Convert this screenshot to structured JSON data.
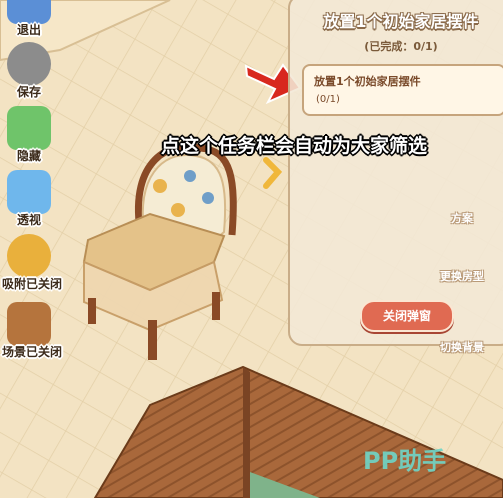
{
  "sidebar": {
    "items": [
      {
        "label": "退出",
        "icon": "exit-icon"
      },
      {
        "label": "保存",
        "icon": "save-icon"
      },
      {
        "label": "隐藏",
        "icon": "hide-icon"
      },
      {
        "label": "透视",
        "icon": "cube-icon"
      },
      {
        "label": "吸附已关闭",
        "icon": "magnet-icon"
      },
      {
        "label": "场景已关闭",
        "icon": "scene-icon"
      }
    ]
  },
  "task_panel": {
    "title": "放置1个初始家居摆件",
    "progress": "(已完成：0/1)",
    "task": {
      "name": "放置1个初始家居摆件",
      "progress": "(0/1)"
    },
    "close_label": "关闭弹窗",
    "hidden_buttons": [
      "方案",
      "更换房型",
      "切换背景"
    ]
  },
  "caption": "点这个任务栏会自动为大家筛选",
  "watermark": "PP助手",
  "colors": {
    "accent": "#e06a52",
    "panel_border": "#c9ad88",
    "arrow": "#d8281e",
    "watermark": "#6fd6c8"
  }
}
